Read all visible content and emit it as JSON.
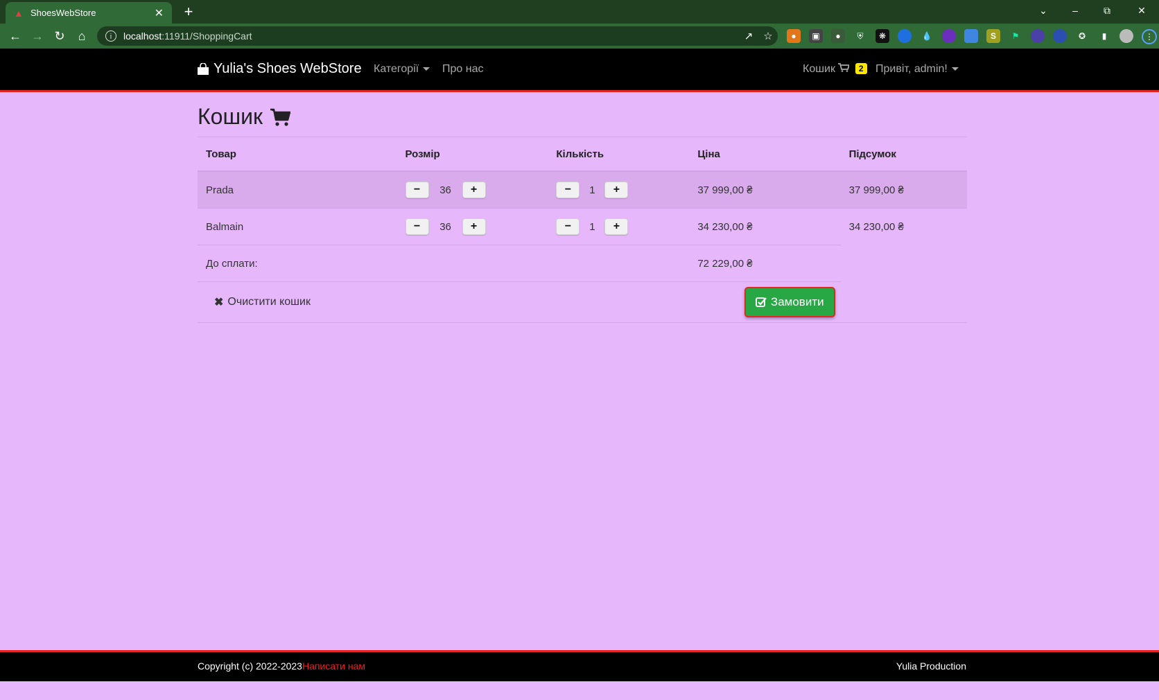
{
  "browser": {
    "tab_title": "ShoesWebStore",
    "url_host": "localhost",
    "url_path": ":11911/ShoppingCart"
  },
  "nav": {
    "brand": "Yulia's Shoes WebStore",
    "categories": "Категорії",
    "about": "Про нас",
    "cart": "Кошик",
    "cart_count": "2",
    "greeting": "Привіт, admin!"
  },
  "page": {
    "title": "Кошик"
  },
  "table": {
    "headers": [
      "Товар",
      "Розмір",
      "Кількість",
      "Ціна",
      "Підсумок"
    ],
    "rows": [
      {
        "product": "Prada",
        "size": "36",
        "qty": "1",
        "price": "37 999,00 ₴",
        "subtotal": "37 999,00 ₴"
      },
      {
        "product": "Balmain",
        "size": "36",
        "qty": "1",
        "price": "34 230,00 ₴",
        "subtotal": "34 230,00 ₴"
      }
    ],
    "total_label": "До сплати:",
    "total_value": "72 229,00 ₴",
    "minus": "−",
    "plus": "+"
  },
  "actions": {
    "clear": "Очистити кошик",
    "order": "Замовити"
  },
  "footer": {
    "copyright": "Copyright (c) 2022-2023",
    "contact": "Написати нам",
    "right": "Yulia Production"
  },
  "colors": {
    "page_bg": "#e6b8fb",
    "accent_red": "#e32525",
    "order_green": "#28a745",
    "badge_yellow": "#ffe600"
  }
}
